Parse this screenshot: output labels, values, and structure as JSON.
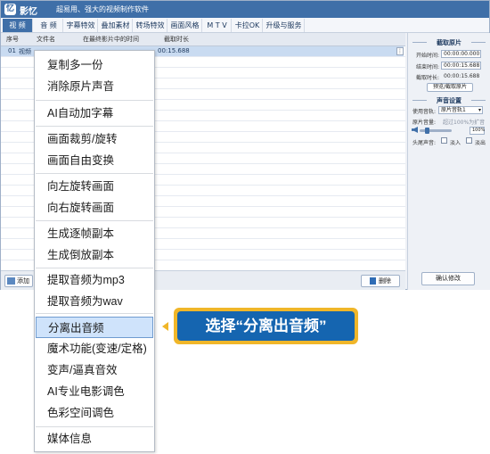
{
  "app": {
    "name": "影忆",
    "logo_glyph": "忆",
    "slogan": "超易用、强大的视频制作软件",
    "accent_color": "#3f6fa8"
  },
  "menubar": {
    "tabs": [
      {
        "label": "视 频",
        "active": true
      },
      {
        "label": "音 频",
        "active": false
      },
      {
        "label": "字幕特效",
        "active": false
      },
      {
        "label": "叠加素材",
        "active": false
      },
      {
        "label": "转场特效",
        "active": false
      },
      {
        "label": "画面风格",
        "active": false
      },
      {
        "label": "M T V",
        "active": false
      },
      {
        "label": "卡拉OK",
        "active": false
      },
      {
        "label": "升级与服务",
        "active": false
      }
    ]
  },
  "file_list": {
    "headers": [
      "序号",
      "文件名",
      "在最终影片中的时间",
      "截取时长"
    ],
    "selected_row": {
      "index": "01",
      "name": "视频",
      "duration": "00:15.688"
    }
  },
  "bottom_bar": {
    "add_label": "添加",
    "delete_label": "删除"
  },
  "right_panel": {
    "clip_section": {
      "title": "截取原片",
      "start_label": "开始时间:",
      "start_value": "00:00:00.000",
      "end_label": "结束时间:",
      "end_value": "00:00:15.688",
      "length_label": "截取时长:",
      "length_value": "00:00:15.688",
      "preview_button": "预览/截取原片"
    },
    "audio_section": {
      "title": "声音设置",
      "track_label": "使用音轨:",
      "track_value": "原片音轨1",
      "volume_label": "原片音量:",
      "volume_hint": "超过100%为扩音",
      "volume_value": "100%",
      "volume_level": 0.25,
      "fade_label": "头尾声音:",
      "fade_in": "淡入",
      "fade_out": "淡出"
    },
    "confirm_button": "确认修改"
  },
  "context_menu": {
    "groups": [
      [
        "复制多一份",
        "消除原片声音"
      ],
      [
        "AI自动加字幕"
      ],
      [
        "画面裁剪/旋转",
        "画面自由变换"
      ],
      [
        "向左旋转画面",
        "向右旋转画面"
      ],
      [
        "生成逐帧副本",
        "生成倒放副本"
      ],
      [
        "提取音频为mp3",
        "提取音频为wav"
      ],
      [
        "分离出音频",
        "魔术功能(变速/定格)",
        "变声/逼真音效",
        "AI专业电影调色",
        "色彩空间调色"
      ],
      [
        "媒体信息"
      ]
    ],
    "highlighted_item": "分离出音频"
  },
  "callout": {
    "text": "选择“分离出音频”",
    "border_color": "#f0b629",
    "fill_color": "#1565b0"
  }
}
